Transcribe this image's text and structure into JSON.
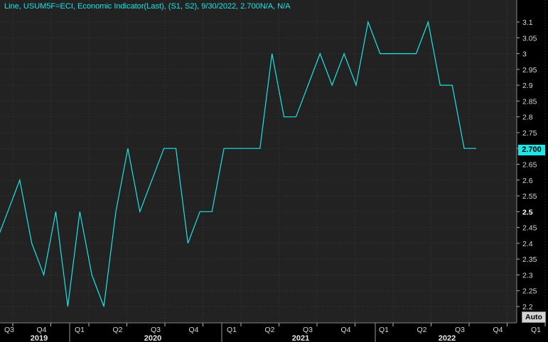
{
  "legend": {
    "line1": "Line, USUM5F=ECI, Economic Indicator(Last), (S1, S2), 9/30/2022, 2.700",
    "line2": "N/A, N/A"
  },
  "last_value": "2.700",
  "auto_label": "Auto",
  "colors": {
    "background": "#000000",
    "plot_bg": "#222222",
    "line": "#19e6e6",
    "grid": "#3a3a3a"
  },
  "chart_data": {
    "type": "line",
    "title": "",
    "xlabel": "",
    "ylabel": "",
    "ylim": [
      2.17,
      3.13
    ],
    "yticks": [
      "2.2",
      "2.25",
      "2.3",
      "2.35",
      "2.4",
      "2.45",
      "2.5",
      "2.55",
      "2.6",
      "2.65",
      "2.7",
      "2.75",
      "2.8",
      "2.85",
      "2.9",
      "2.95",
      "3",
      "3.05",
      "3.1"
    ],
    "ytick_bold": "2.5",
    "x_quarter_labels": [
      "Q3",
      "Q4",
      "Q1",
      "Q2",
      "Q3",
      "Q4",
      "Q1",
      "Q2",
      "Q3",
      "Q4",
      "Q1",
      "Q2",
      "Q3",
      "Q4",
      "Q1",
      "Q2",
      "Q3",
      "Q4"
    ],
    "x_year_labels": [
      "2019",
      "2020",
      "2021",
      "2022"
    ],
    "grid": true,
    "series": [
      {
        "x": [
          "2018-06-30",
          "2018-07-31",
          "2018-08-31",
          "2018-09-30",
          "2018-10-31",
          "2018-11-30",
          "2018-12-31",
          "2019-01-31",
          "2019-02-28",
          "2019-03-31",
          "2019-04-30",
          "2019-05-31",
          "2019-06-30",
          "2019-07-31",
          "2019-08-31",
          "2019-09-30",
          "2019-10-31",
          "2019-11-30",
          "2019-12-31",
          "2020-01-31",
          "2020-02-29",
          "2020-03-31",
          "2020-04-30",
          "2020-05-31",
          "2020-06-30",
          "2020-07-31",
          "2020-08-31",
          "2020-09-30",
          "2020-10-31",
          "2020-11-30",
          "2020-12-31",
          "2021-01-31",
          "2021-02-28",
          "2021-03-31",
          "2021-04-30",
          "2021-05-31",
          "2021-06-30",
          "2021-07-31",
          "2021-08-31",
          "2021-09-30",
          "2021-10-31"
        ],
        "values": [
          2.4,
          2.5,
          2.6,
          2.4,
          2.3,
          2.5,
          2.2,
          2.5,
          2.3,
          2.2,
          2.5,
          2.7,
          2.5,
          2.6,
          2.7,
          2.7,
          2.4,
          2.5,
          2.5,
          2.7,
          2.7,
          2.7,
          2.7,
          3.0,
          2.8,
          2.8,
          2.9,
          3.0,
          2.9,
          3.0,
          2.9,
          3.1,
          3.0,
          3.0,
          3.0,
          3.0,
          3.1,
          2.9,
          2.9,
          2.7,
          2.7
        ]
      }
    ]
  }
}
